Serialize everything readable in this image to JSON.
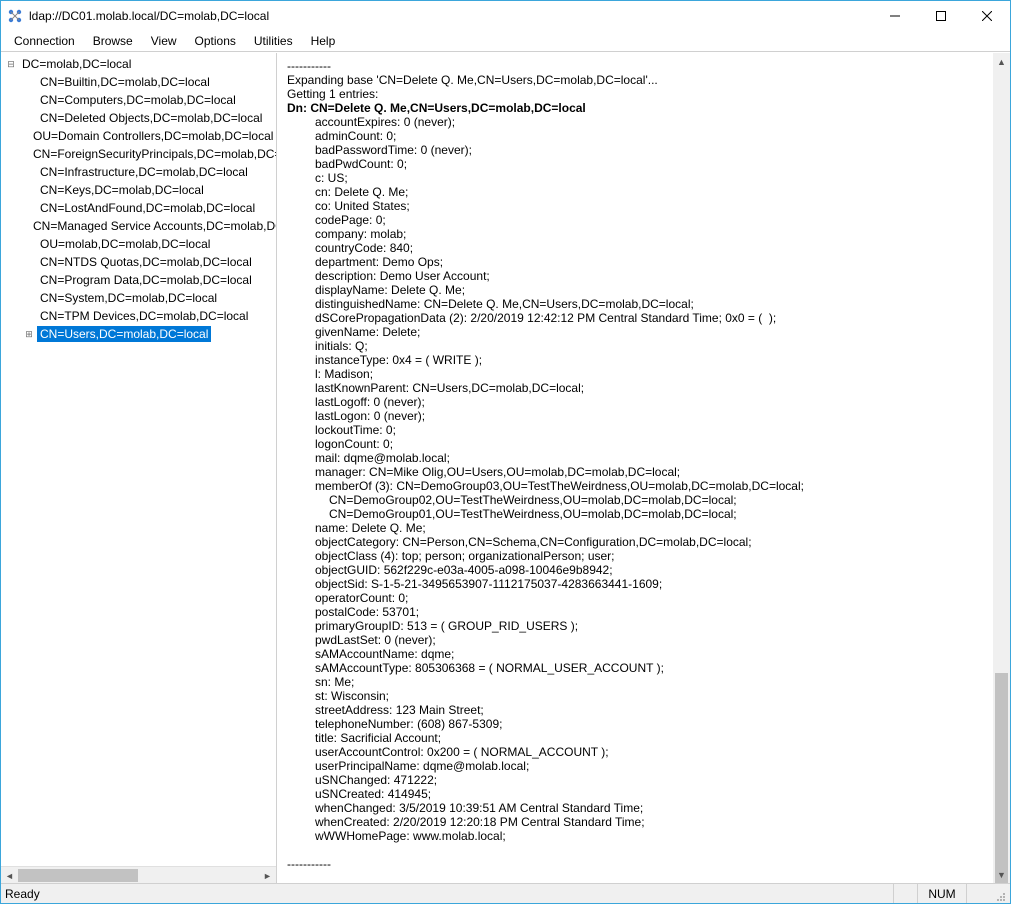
{
  "window": {
    "title": "ldap://DC01.molab.local/DC=molab,DC=local"
  },
  "menu": {
    "items": [
      "Connection",
      "Browse",
      "View",
      "Options",
      "Utilities",
      "Help"
    ]
  },
  "tree": {
    "root": {
      "label": "DC=molab,DC=local",
      "expanded": true,
      "children": [
        {
          "label": "CN=Builtin,DC=molab,DC=local"
        },
        {
          "label": "CN=Computers,DC=molab,DC=local"
        },
        {
          "label": "CN=Deleted Objects,DC=molab,DC=local"
        },
        {
          "label": "OU=Domain Controllers,DC=molab,DC=local"
        },
        {
          "label": "CN=ForeignSecurityPrincipals,DC=molab,DC=local"
        },
        {
          "label": "CN=Infrastructure,DC=molab,DC=local"
        },
        {
          "label": "CN=Keys,DC=molab,DC=local"
        },
        {
          "label": "CN=LostAndFound,DC=molab,DC=local"
        },
        {
          "label": "CN=Managed Service Accounts,DC=molab,DC=local"
        },
        {
          "label": "OU=molab,DC=molab,DC=local"
        },
        {
          "label": "CN=NTDS Quotas,DC=molab,DC=local"
        },
        {
          "label": "CN=Program Data,DC=molab,DC=local"
        },
        {
          "label": "CN=System,DC=molab,DC=local"
        },
        {
          "label": "CN=TPM Devices,DC=molab,DC=local"
        },
        {
          "label": "CN=Users,DC=molab,DC=local",
          "selected": true,
          "expandable": true
        }
      ]
    }
  },
  "details": {
    "separator": "-----------",
    "expanding": "Expanding base 'CN=Delete Q. Me,CN=Users,DC=molab,DC=local'...",
    "getting": "Getting 1 entries:",
    "dn": "Dn: CN=Delete Q. Me,CN=Users,DC=molab,DC=local",
    "attributes": [
      "accountExpires: 0 (never);",
      "adminCount: 0;",
      "badPasswordTime: 0 (never);",
      "badPwdCount: 0;",
      "c: US;",
      "cn: Delete Q. Me;",
      "co: United States;",
      "codePage: 0;",
      "company: molab;",
      "countryCode: 840;",
      "department: Demo Ops;",
      "description: Demo User Account;",
      "displayName: Delete Q. Me;",
      "distinguishedName: CN=Delete Q. Me,CN=Users,DC=molab,DC=local;",
      "dSCorePropagationData (2): 2/20/2019 12:42:12 PM Central Standard Time; 0x0 = (  );",
      "givenName: Delete;",
      "initials: Q;",
      "instanceType: 0x4 = ( WRITE );",
      "l: Madison;",
      "lastKnownParent: CN=Users,DC=molab,DC=local;",
      "lastLogoff: 0 (never);",
      "lastLogon: 0 (never);",
      "lockoutTime: 0;",
      "logonCount: 0;",
      "mail: dqme@molab.local;",
      "manager: CN=Mike Olig,OU=Users,OU=molab,DC=molab,DC=local;",
      "memberOf (3): CN=DemoGroup03,OU=TestTheWeirdness,OU=molab,DC=molab,DC=local;",
      "    CN=DemoGroup02,OU=TestTheWeirdness,OU=molab,DC=molab,DC=local;",
      "    CN=DemoGroup01,OU=TestTheWeirdness,OU=molab,DC=molab,DC=local;",
      "name: Delete Q. Me;",
      "objectCategory: CN=Person,CN=Schema,CN=Configuration,DC=molab,DC=local;",
      "objectClass (4): top; person; organizationalPerson; user;",
      "objectGUID: 562f229c-e03a-4005-a098-10046e9b8942;",
      "objectSid: S-1-5-21-3495653907-1112175037-4283663441-1609;",
      "operatorCount: 0;",
      "postalCode: 53701;",
      "primaryGroupID: 513 = ( GROUP_RID_USERS );",
      "pwdLastSet: 0 (never);",
      "sAMAccountName: dqme;",
      "sAMAccountType: 805306368 = ( NORMAL_USER_ACCOUNT );",
      "sn: Me;",
      "st: Wisconsin;",
      "streetAddress: 123 Main Street;",
      "telephoneNumber: (608) 867-5309;",
      "title: Sacrificial Account;",
      "userAccountControl: 0x200 = ( NORMAL_ACCOUNT );",
      "userPrincipalName: dqme@molab.local;",
      "uSNChanged: 471222;",
      "uSNCreated: 414945;",
      "whenChanged: 3/5/2019 10:39:51 AM Central Standard Time;",
      "whenCreated: 2/20/2019 12:20:18 PM Central Standard Time;",
      "wWWHomePage: www.molab.local;"
    ]
  },
  "status": {
    "ready": "Ready",
    "num": "NUM"
  }
}
